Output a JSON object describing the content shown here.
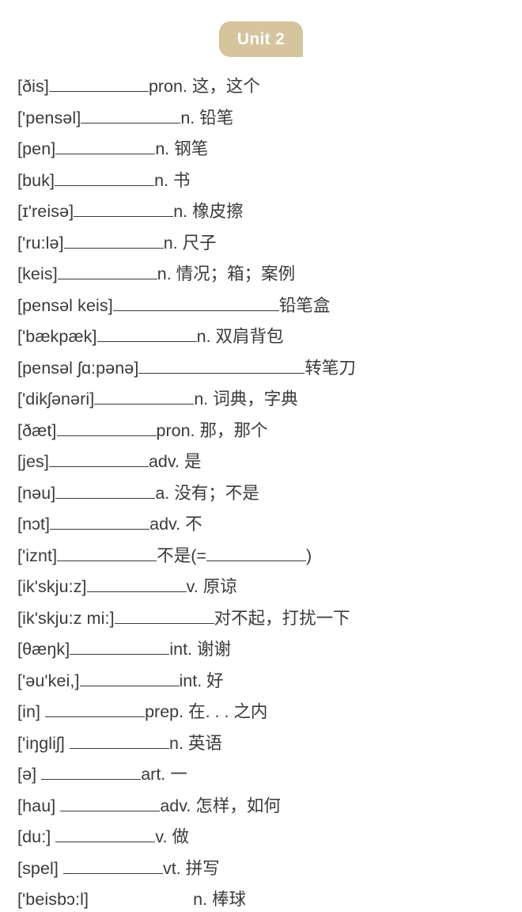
{
  "unit_badge": {
    "label": "Unit 2",
    "background_color": "#d5c49c",
    "text_color": "#ffffff"
  },
  "page": {
    "background_color": "#ffffff",
    "text_color": "#3a3a3a"
  },
  "word_list": [
    {
      "phonetic": "[ðis]",
      "blank_width": 126,
      "meaning": "pron. 这，这个",
      "lead_space": false
    },
    {
      "phonetic": "['pensəl]",
      "blank_width": 126,
      "meaning": "n. 铅笔",
      "lead_space": false
    },
    {
      "phonetic": "[pen]",
      "blank_width": 126,
      "meaning": "n. 钢笔",
      "lead_space": false
    },
    {
      "phonetic": "[buk]",
      "blank_width": 126,
      "meaning": "n. 书",
      "lead_space": false
    },
    {
      "phonetic": "[ɪ'reisə]",
      "blank_width": 126,
      "meaning": "n. 橡皮擦",
      "lead_space": false
    },
    {
      "phonetic": "['ru:lə]",
      "blank_width": 126,
      "meaning": "n. 尺子",
      "lead_space": false
    },
    {
      "phonetic": "[keis]",
      "blank_width": 126,
      "meaning": "n. 情况；箱；案例",
      "lead_space": false
    },
    {
      "phonetic": "[pensəl keis]",
      "blank_width": 210,
      "meaning": "铅笔盒",
      "lead_space": false
    },
    {
      "phonetic": "['bækpæk]",
      "blank_width": 126,
      "meaning": "n. 双肩背包",
      "lead_space": false
    },
    {
      "phonetic": "[pensəl ʃɑ:pənə]",
      "blank_width": 210,
      "meaning": "转笔刀",
      "lead_space": false
    },
    {
      "phonetic": "['dikʃənəri]",
      "blank_width": 126,
      "meaning": "n. 词典，字典",
      "lead_space": false
    },
    {
      "phonetic": "[ðæt]",
      "blank_width": 126,
      "meaning": "pron. 那，那个",
      "lead_space": false
    },
    {
      "phonetic": "[jes]",
      "blank_width": 126,
      "meaning": "adv. 是",
      "lead_space": false
    },
    {
      "phonetic": "[nəu]",
      "blank_width": 126,
      "meaning": "a. 没有；不是",
      "lead_space": false
    },
    {
      "phonetic": "[nɔt]",
      "blank_width": 126,
      "meaning": "adv. 不",
      "lead_space": false
    },
    {
      "phonetic": "['iznt]",
      "blank_width": 126,
      "meaning": "不是(=",
      "lead_space": false,
      "trailing_blank_width": 126,
      "trailing_text": ")"
    },
    {
      "phonetic": "[ik'skju:z]",
      "blank_width": 126,
      "meaning": "v. 原谅",
      "lead_space": false
    },
    {
      "phonetic": "[ik'skju:z mi:]",
      "blank_width": 126,
      "meaning": "对不起，打扰一下",
      "lead_space": false
    },
    {
      "phonetic": "[θæŋk]",
      "blank_width": 126,
      "meaning": "int. 谢谢",
      "lead_space": false
    },
    {
      "phonetic": "['əu'kei,]",
      "blank_width": 126,
      "meaning": "int. 好",
      "lead_space": false
    },
    {
      "phonetic": "[in]",
      "blank_width": 126,
      "meaning": "prep. 在. . . 之内",
      "lead_space": true
    },
    {
      "phonetic": "['iŋgliʃ]",
      "blank_width": 126,
      "meaning": "n. 英语",
      "lead_space": true
    },
    {
      "phonetic": "[ə]",
      "blank_width": 126,
      "meaning": "art. 一",
      "lead_space": true
    },
    {
      "phonetic": "[hau]",
      "blank_width": 126,
      "meaning": "adv. 怎样，如何",
      "lead_space": true
    },
    {
      "phonetic": "[du:]",
      "blank_width": 126,
      "meaning": "v. 做",
      "lead_space": true
    },
    {
      "phonetic": "[spel]",
      "blank_width": 126,
      "meaning": "vt. 拼写",
      "lead_space": true
    },
    {
      "phonetic": "['beisbɔ:l]",
      "blank_width": 126,
      "meaning": "n. 棒球",
      "lead_space": true,
      "blank_hidden": true
    }
  ]
}
